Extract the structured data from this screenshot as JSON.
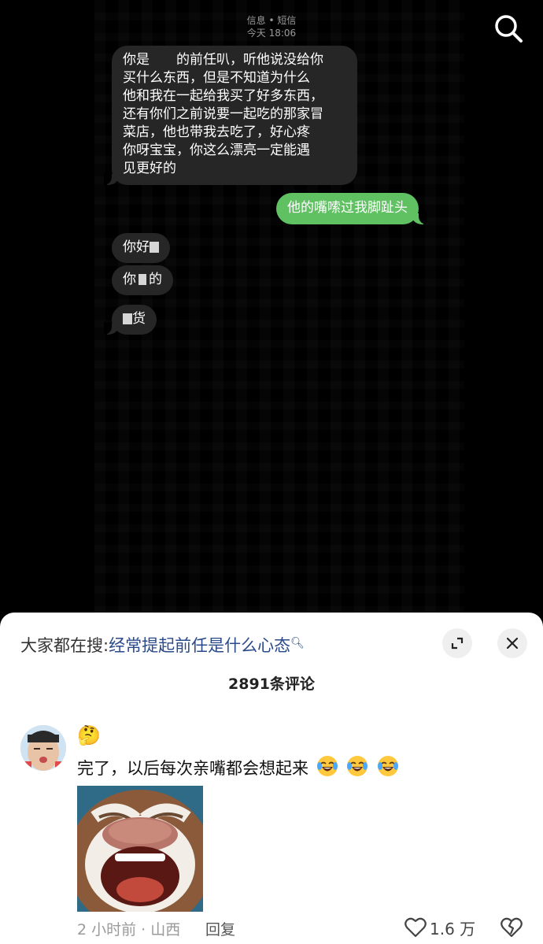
{
  "sms": {
    "header_line1": "信息 • 短信",
    "header_line2": "今天 18:06"
  },
  "messages": [
    {
      "side": "received",
      "lines": [
        "你是　　的前任叭，听他说没给你",
        "买什么东西，但是不知道为什么",
        "他和我在一起给我买了好多东西，",
        "还有你们之前说要一起吃的那家冒",
        "菜店，他也带我去吃了，好心疼",
        "你呀宝宝，你这么漂亮一定能遇",
        "见更好的"
      ]
    },
    {
      "side": "sent",
      "text": "他的嘴嗦过我脚趾头"
    },
    {
      "side": "received",
      "text_a": "你好",
      "text_b": ""
    },
    {
      "side": "received",
      "text_a": "你",
      "text_b": "的"
    },
    {
      "side": "received",
      "text_a": "",
      "text_b": "货"
    }
  ],
  "panel": {
    "hot_search_prefix": "大家都在搜:",
    "hot_search_keyword": "经常提起前任是什么心态",
    "comment_count": "2891条评论"
  },
  "comment": {
    "badge_emoji": "🤔",
    "text": "完了，以后每次亲嘴都会想起来",
    "time_location": "2 小时前 · 山西",
    "reply_label": "回复",
    "like_count": "1.6 万"
  },
  "icons": {
    "search": "search-icon",
    "expand": "expand-icon",
    "close": "close-icon",
    "like": "heart-outline-icon",
    "dislike": "broken-heart-icon",
    "laugh": "tears-of-joy-emoji-icon"
  },
  "colors": {
    "sent_bubble": "#5fc162",
    "received_bubble": "#262626",
    "keyword": "#2b4a8a"
  }
}
